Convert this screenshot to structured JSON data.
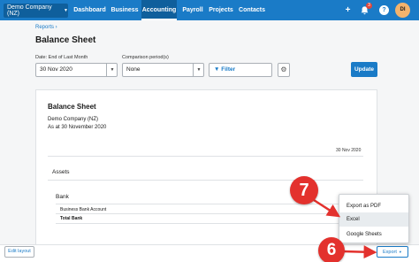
{
  "nav": {
    "org_name": "Demo Company (NZ)",
    "items": [
      {
        "label": "Dashboard"
      },
      {
        "label": "Business"
      },
      {
        "label": "Accounting"
      },
      {
        "label": "Payroll"
      },
      {
        "label": "Projects"
      },
      {
        "label": "Contacts"
      }
    ],
    "active_item": "Accounting",
    "plus_icon": "+",
    "notifications_count": "3",
    "help_icon": "?",
    "avatar_initials": "DI"
  },
  "breadcrumb": "Reports ›",
  "page_title": "Balance Sheet",
  "filters": {
    "date_label": "Date: End of Last Month",
    "date_value": "30 Nov 2020",
    "comparison_label": "Comparison period(s)",
    "comparison_value": "None",
    "filter_label": "Filter",
    "update_label": "Update"
  },
  "report": {
    "title": "Balance Sheet",
    "org": "Demo Company (NZ)",
    "as_at": "As at 30 November 2020",
    "column_header": "30 Nov 2020",
    "section": "Assets",
    "subsection": "Bank",
    "account_row": "Business Bank Account",
    "total_row": "Total Bank"
  },
  "bottom": {
    "edit_layout_label": "Edit layout",
    "export_label": "Export"
  },
  "export_menu": {
    "items": [
      {
        "label": "Export as PDF"
      },
      {
        "label": "Excel"
      },
      {
        "label": "Google Sheets"
      }
    ],
    "highlighted": "Excel"
  },
  "callouts": {
    "step_export_menu": "7",
    "step_export_button": "6"
  },
  "colors": {
    "brand_blue": "#1a7bc7",
    "nav_dark": "#0f5f9c",
    "callout_red": "#e3312d"
  }
}
